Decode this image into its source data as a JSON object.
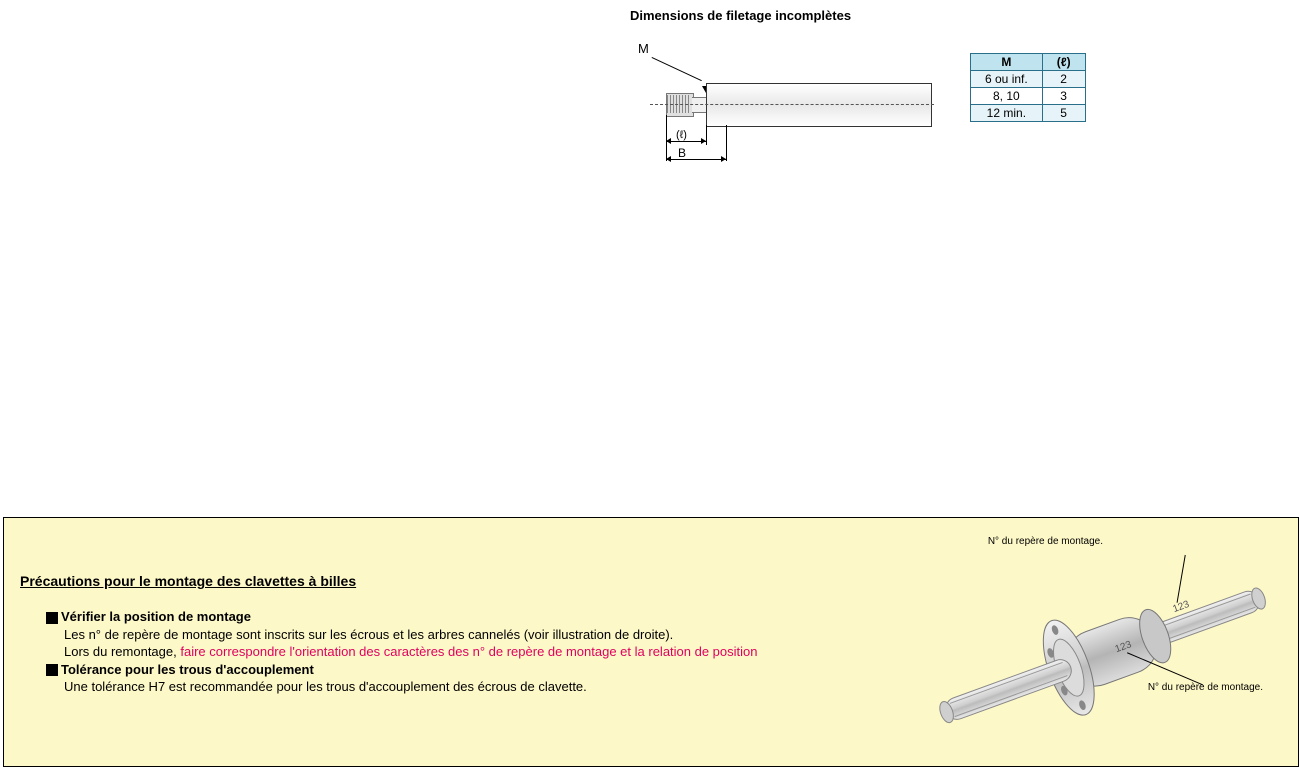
{
  "top": {
    "title": "Dimensions de filetage incomplètes",
    "label_M": "M",
    "label_e": "(ℓ)",
    "label_B": "B"
  },
  "chart_data": {
    "type": "table",
    "title": "Dimensions de filetage incomplètes",
    "columns": [
      "M",
      "(ℓ)"
    ],
    "rows": [
      {
        "M": "6 ou inf.",
        "e": "2"
      },
      {
        "M": "8, 10",
        "e": "3"
      },
      {
        "M": "12 min.",
        "e": "5"
      }
    ]
  },
  "precaution": {
    "title": "Précautions pour le montage des clavettes à billes",
    "item1_title": "Vérifier la position de montage",
    "item1_line1": "Les n° de repère de montage sont inscrits sur les écrous et les arbres cannelés (voir illustration de droite).",
    "item1_line2a": "Lors du remontage, ",
    "item1_line2b": "faire correspondre l'orientation des caractères des n° de repère de montage et la relation de position",
    "item2_title": "Tolérance pour les trous d'accouplement",
    "item2_line1": "Une tolérance H7 est recommandée pour les trous d'accouplement des écrous de clavette.",
    "caption_top": "N° du repère de montage.",
    "caption_bot": "N° du repère de montage.",
    "num_label": "123"
  }
}
